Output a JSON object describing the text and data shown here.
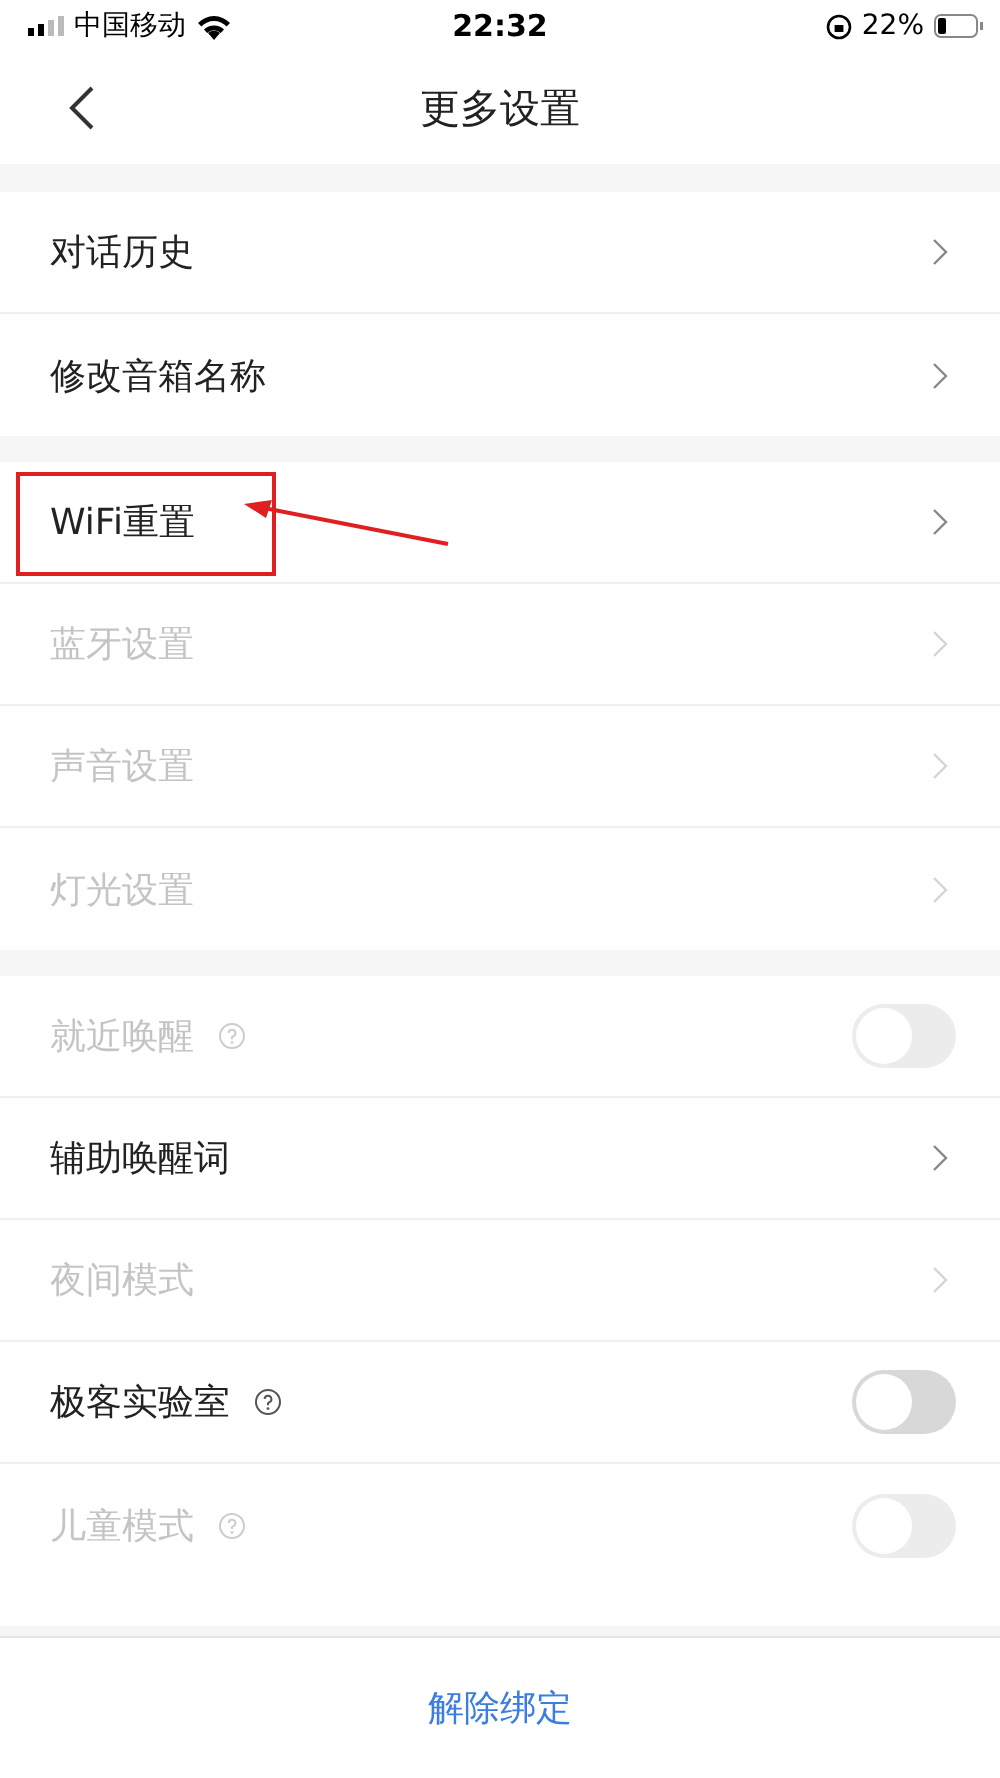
{
  "status_bar": {
    "carrier": "中国移动",
    "time": "22:32",
    "battery": "22%"
  },
  "nav": {
    "title": "更多设置"
  },
  "groups": [
    {
      "rows": [
        {
          "label": "对话历史",
          "kind": "link",
          "disabled": false,
          "highlighted": false
        },
        {
          "label": "修改音箱名称",
          "kind": "link",
          "disabled": false,
          "highlighted": false
        }
      ]
    },
    {
      "rows": [
        {
          "label": "WiFi重置",
          "kind": "link",
          "disabled": false,
          "highlighted": true
        },
        {
          "label": "蓝牙设置",
          "kind": "link",
          "disabled": true,
          "highlighted": false
        },
        {
          "label": "声音设置",
          "kind": "link",
          "disabled": true,
          "highlighted": false
        },
        {
          "label": "灯光设置",
          "kind": "link",
          "disabled": true,
          "highlighted": false
        }
      ]
    },
    {
      "rows": [
        {
          "label": "就近唤醒",
          "kind": "toggle",
          "help": true,
          "on": false,
          "disabled": true,
          "highlighted": false
        },
        {
          "label": "辅助唤醒词",
          "kind": "link",
          "disabled": false,
          "highlighted": false
        },
        {
          "label": "夜间模式",
          "kind": "link",
          "disabled": true,
          "highlighted": false
        },
        {
          "label": "极客实验室",
          "kind": "toggle",
          "help": true,
          "on": false,
          "disabled": false,
          "highlighted": false
        },
        {
          "label": "儿童模式",
          "kind": "toggle",
          "help": true,
          "on": false,
          "disabled": true,
          "highlighted": false
        }
      ]
    }
  ],
  "footer_button": "解除绑定"
}
